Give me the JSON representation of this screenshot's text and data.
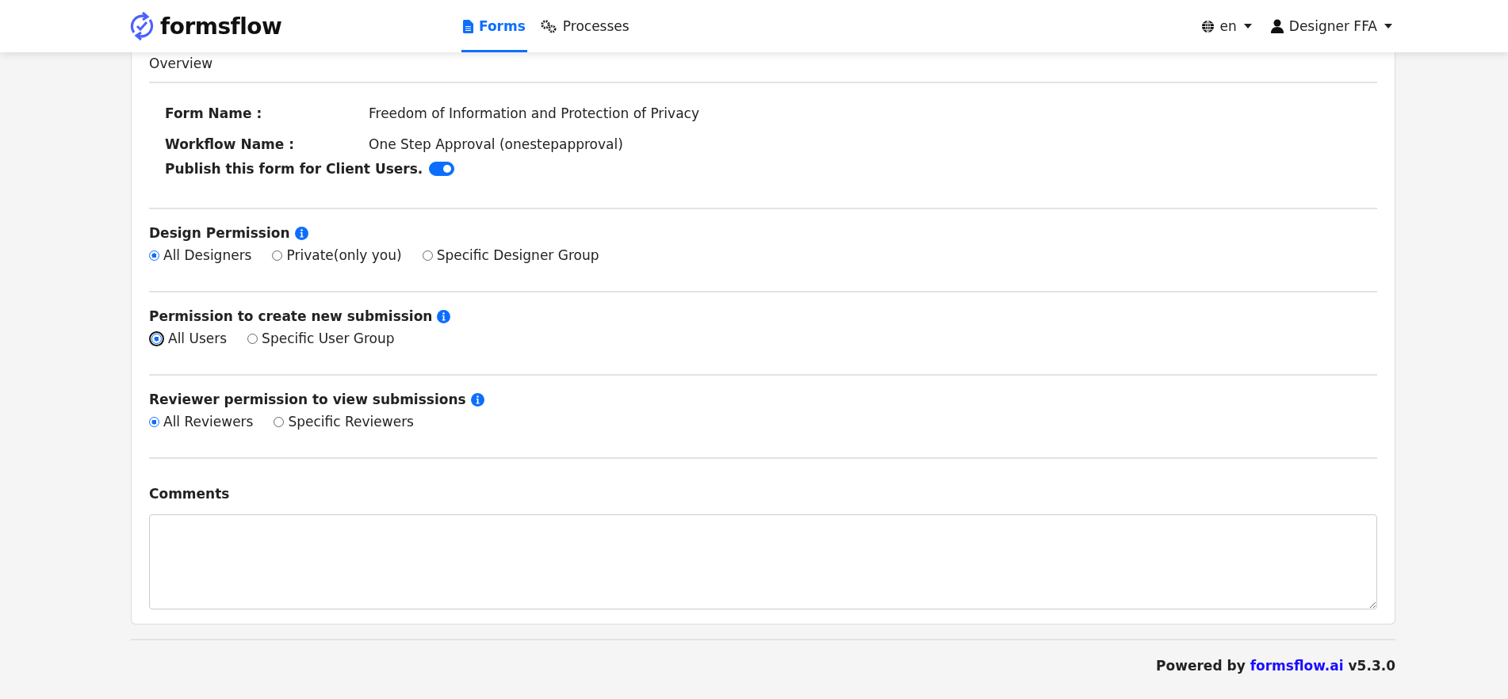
{
  "header": {
    "logo": "formsflow",
    "nav": [
      {
        "label": "Forms",
        "selected": true
      },
      {
        "label": "Processes",
        "selected": false
      }
    ],
    "language": "en",
    "user": "Designer FFA"
  },
  "overview": {
    "title": "Overview",
    "fields": [
      {
        "label": "Form Name :",
        "value": "Freedom of Information and Protection of Privacy"
      },
      {
        "label": "Workflow Name :",
        "value": "One Step Approval (onestepapproval)"
      }
    ],
    "publish": {
      "label": "Publish this form for Client Users.",
      "on": true
    }
  },
  "permissions": [
    {
      "title": "Design Permission",
      "options": [
        {
          "label": "All Designers",
          "selected": true,
          "focused": false
        },
        {
          "label": "Private(only you)",
          "selected": false,
          "focused": false
        },
        {
          "label": "Specific Designer Group",
          "selected": false,
          "focused": false
        }
      ]
    },
    {
      "title": "Permission to create new submission",
      "options": [
        {
          "label": "All Users",
          "selected": true,
          "focused": true
        },
        {
          "label": "Specific User Group",
          "selected": false,
          "focused": false
        }
      ]
    },
    {
      "title": "Reviewer permission to view submissions",
      "options": [
        {
          "label": "All Reviewers",
          "selected": true,
          "focused": false
        },
        {
          "label": "Specific Reviewers",
          "selected": false,
          "focused": false
        }
      ]
    }
  ],
  "comments": {
    "label": "Comments"
  },
  "footer": {
    "prefix": "Powered by",
    "link": "formsflow.ai",
    "version": "v5.3.0"
  }
}
